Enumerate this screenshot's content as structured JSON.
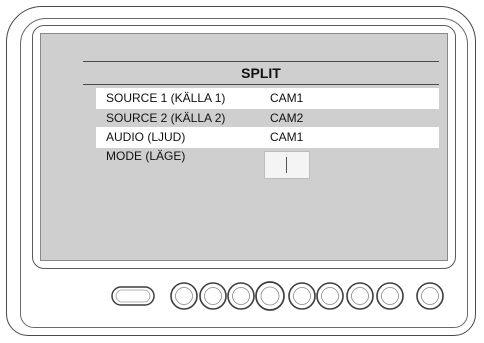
{
  "menu": {
    "title": "SPLIT",
    "rows": [
      {
        "label": "SOURCE 1 (KÄLLA 1)",
        "value": "CAM1"
      },
      {
        "label": "SOURCE 2 (KÄLLA 2)",
        "value": "CAM2"
      },
      {
        "label": "AUDIO (LJUD)",
        "value": "CAM1"
      },
      {
        "label": "MODE (LÄGE)",
        "value": ""
      }
    ]
  },
  "colors": {
    "screen_bg": "#cfcfcf",
    "highlight_row": "#ffffff",
    "outline": "#4a4a4a"
  },
  "buttons": {
    "power": "power-button",
    "round": [
      "button-1",
      "button-2",
      "button-3",
      "button-4",
      "button-5",
      "button-6",
      "button-7"
    ]
  }
}
